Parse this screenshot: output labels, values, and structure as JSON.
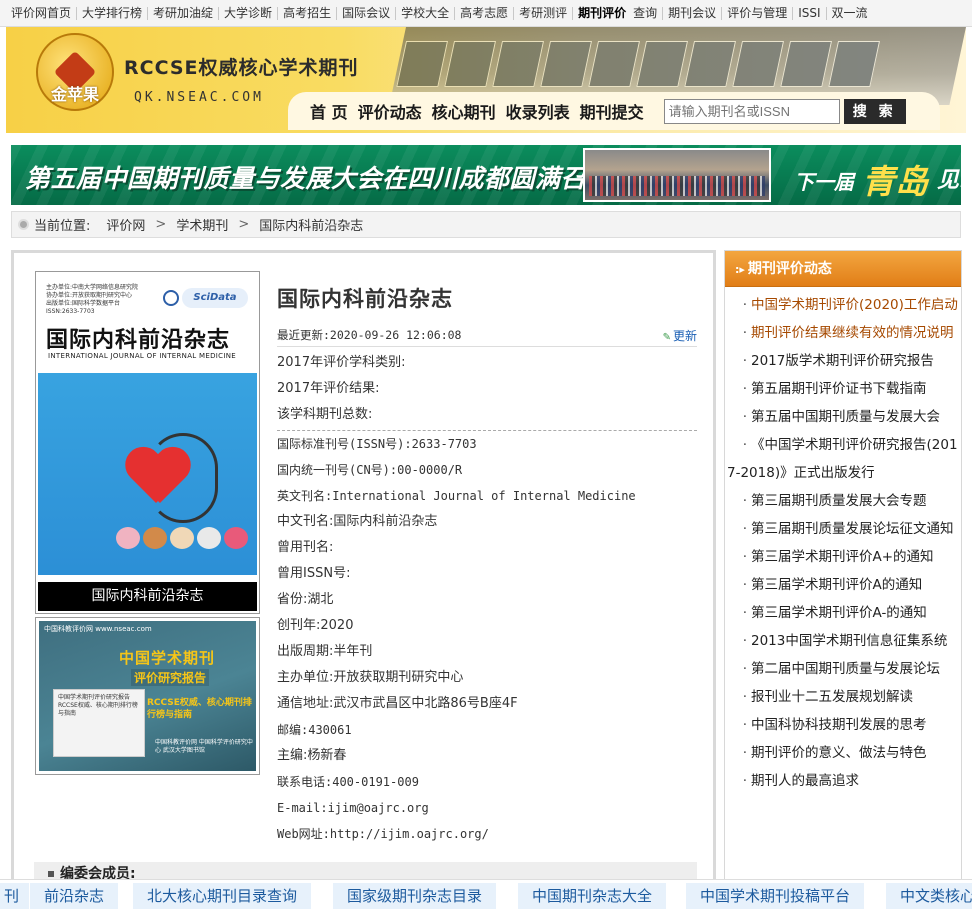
{
  "topnav": [
    "评价网首页",
    "大学排行榜",
    "考研加油绽",
    "大学诊断",
    "高考招生",
    "国际会议",
    "学校大全",
    "高考志愿",
    "考研测评",
    "期刊评价",
    "查询",
    "期刊会议",
    "评价与管理",
    "ISSI",
    "双一流"
  ],
  "header": {
    "logo_text": "金苹果",
    "title": "RCCSE权威核心学术期刊",
    "url": "QK.NSEAC.COM",
    "nav": [
      "首 页",
      "评价动态",
      "核心期刊",
      "收录列表",
      "期刊提交"
    ],
    "search_placeholder": "请输入期刊名或ISSN",
    "search_button": "搜 索"
  },
  "banner": {
    "text": "第五届中国期刊质量与发展大会在四川成都圆满召开!",
    "next": "下一届",
    "city": "青岛",
    "tail": "见!"
  },
  "breadcrumb": {
    "label": "当前位置:",
    "items": [
      "评价网",
      "学术期刊",
      "国际内科前沿杂志"
    ]
  },
  "cover": {
    "lines": [
      "主办单位:中南大学网络信息研究院",
      "协办单位:开放获取期刊研究中心",
      "出版单位:国际科学数据平台",
      "ISSN:2633-7703"
    ],
    "logo_text": "SciData",
    "title": "国际内科前沿杂志",
    "subtitle": "INTERNATIONAL JOURNAL OF INTERNAL MEDICINE",
    "caption": "国际内科前沿杂志"
  },
  "report": {
    "top": "中国科教评价网 www.nseac.com",
    "title1": "中国学术期刊",
    "title2": "评价研究报告",
    "book": "中国学术期刊评价研究报告 RCCSE权威、核心期刊排行榜与指南",
    "sub": "RCCSE权威、核心期刊排行榜与指南",
    "foot": "中国科教评价网 中国科学评价研究中心 武汉大学图书馆"
  },
  "journal": {
    "title": "国际内科前沿杂志",
    "updated_label": "最近更新:2020-09-26 12:06:08",
    "more": "更新",
    "eval": [
      "2017年评价学科类别:",
      "2017年评价结果:",
      "该学科期刊总数:"
    ],
    "fields": [
      "国际标准刊号(ISSN号):2633-7703",
      "国内统一刊号(CN号):00-0000/R",
      "英文刊名:International Journal of Internal Medicine",
      "中文刊名:国际内科前沿杂志",
      "曾用刊名:",
      "曾用ISSN号:",
      "省份:湖北",
      "创刊年:2020",
      "出版周期:半年刊",
      "主办单位:开放获取期刊研究中心",
      "通信地址:武汉市武昌区中北路86号B座4F",
      "邮编:430061",
      "主编:杨新春",
      "联系电话:400-0191-009",
      "E-mail:ijim@oajrc.org",
      "Web网址:http://ijim.oajrc.org/"
    ],
    "editors_label": "编委会成员:"
  },
  "sidebar": {
    "title": "期刊评价动态",
    "items": [
      "中国学术期刊评价(2020)工作启动",
      "期刊评价结果继续有效的情况说明",
      "2017版学术期刊评价研究报告",
      "第五届期刊评价证书下载指南",
      "第五届中国期刊质量与发展大会",
      "《中国学术期刊评价研究报告(2017-2018)》正式出版发行",
      "第三届期刊质量发展大会专题",
      "第三届期刊质量发展论坛征文通知",
      "第三届学术期刊评价A+的通知",
      "第三届学术期刊评价A的通知",
      "第三届学术期刊评价A-的通知",
      "2013中国学术期刊信息征集系统",
      "第二届中国期刊质量与发展论坛",
      "报刊业十二五发展规划解读",
      "中国科协科技期刊发展的思考",
      "期刊评价的意义、做法与特色",
      "期刊人的最高追求"
    ]
  },
  "bottombar": [
    "刊",
    "前沿杂志",
    "北大核心期刊目录查询",
    "国家级期刊杂志目录",
    "中国期刊杂志大全",
    "中国学术期刊投稿平台",
    "中文类核心"
  ],
  "colors": {
    "sidebar_head": "#e8891f",
    "banner": "#0a8a5a",
    "header": "#f7d046",
    "link": "#1a5fb4"
  }
}
